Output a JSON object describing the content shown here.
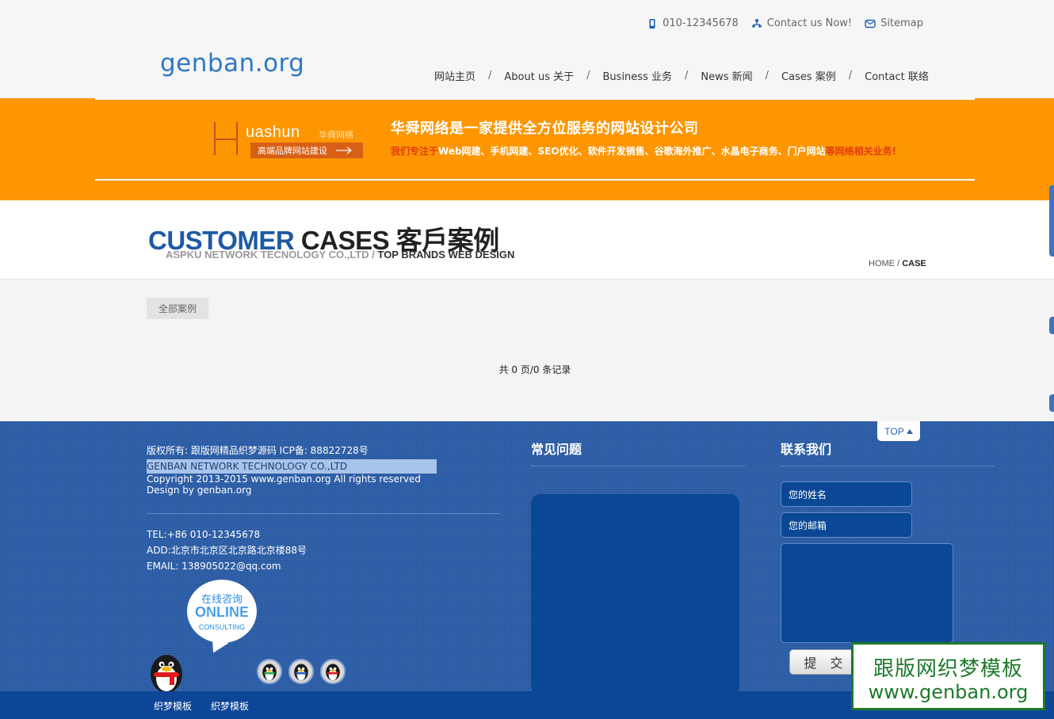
{
  "header": {
    "phone": "010-12345678",
    "contact_label": "Contact us Now!",
    "sitemap_label": "Sitemap",
    "logo_text": "genban.org",
    "nav": [
      {
        "label": "网站主页"
      },
      {
        "label": "About us 关于"
      },
      {
        "label": "Business 业务"
      },
      {
        "label": "News 新闻"
      },
      {
        "label": "Cases 案例"
      },
      {
        "label": "Contact 联络"
      }
    ],
    "separator": "/"
  },
  "banner": {
    "logo_word": "uashun",
    "logo_cn": "华舜网络",
    "logo_pill": "高端品牌网站建设",
    "title": "华舜网络是一家提供全方位服务的网站设计公司",
    "desc_prefix": "我们专注于",
    "desc_main": "Web网建、手机网建、SEO优化、软件开发销售、谷歌海外推广、水晶电子商务、门户网站",
    "desc_suffix": "等网络相关业务!",
    "colors": {
      "background": "#fd9602",
      "highlight": "#e33c0c"
    }
  },
  "page_header": {
    "title_blue": "CUSTOMER",
    "title_black": "CASES 客戶案例",
    "subtitle_grey": "ASPKU NETWORK TECNOLOGY CO.,LTD /",
    "subtitle_dark": "TOP BRANDS WEB DESIGN",
    "breadcrumb_home": "HOME",
    "breadcrumb_sep": "/",
    "breadcrumb_current": "CASE"
  },
  "content": {
    "filter_tab": "全部案例",
    "pager_text": "共 0 页/0 条记录"
  },
  "footer": {
    "copyright_line1": "版权所有: 跟版网精品织梦源码 ICP备: 88822728号",
    "company_line": "GENBAN NETWORK TECHNOLOGY CO.,LTD",
    "copyright_line2": "Copyright 2013-2015 www.genban.org All rights reserved",
    "design_line": "Design by genban.org",
    "tel": "TEL:+86 010-12345678",
    "add": "ADD:北京市北京区北京路北京楼88号",
    "email": "EMAIL: 138905022@qq.com",
    "online_cn": "在线咨询",
    "online_en": "ONLINE",
    "online_sub": "CONSULTING",
    "faq_heading": "常见问题",
    "contact_heading": "联系我们",
    "name_placeholder": "您的姓名",
    "email_placeholder": "您的邮箱",
    "submit_label": "提 交",
    "top_label": "TOP",
    "bottom_links": [
      "织梦模板",
      "织梦模板"
    ]
  },
  "watermark": {
    "line1": "跟版网织梦模板",
    "line2": "www.genban.org"
  },
  "icons": {
    "phone": "phone-icon",
    "contact": "people-icon",
    "sitemap": "mail-icon",
    "top_arrow": "triangle-up-icon"
  },
  "colors": {
    "brand_blue": "#2e78c4",
    "footer_blue": "#2c5ea8",
    "orange": "#fd9602"
  }
}
